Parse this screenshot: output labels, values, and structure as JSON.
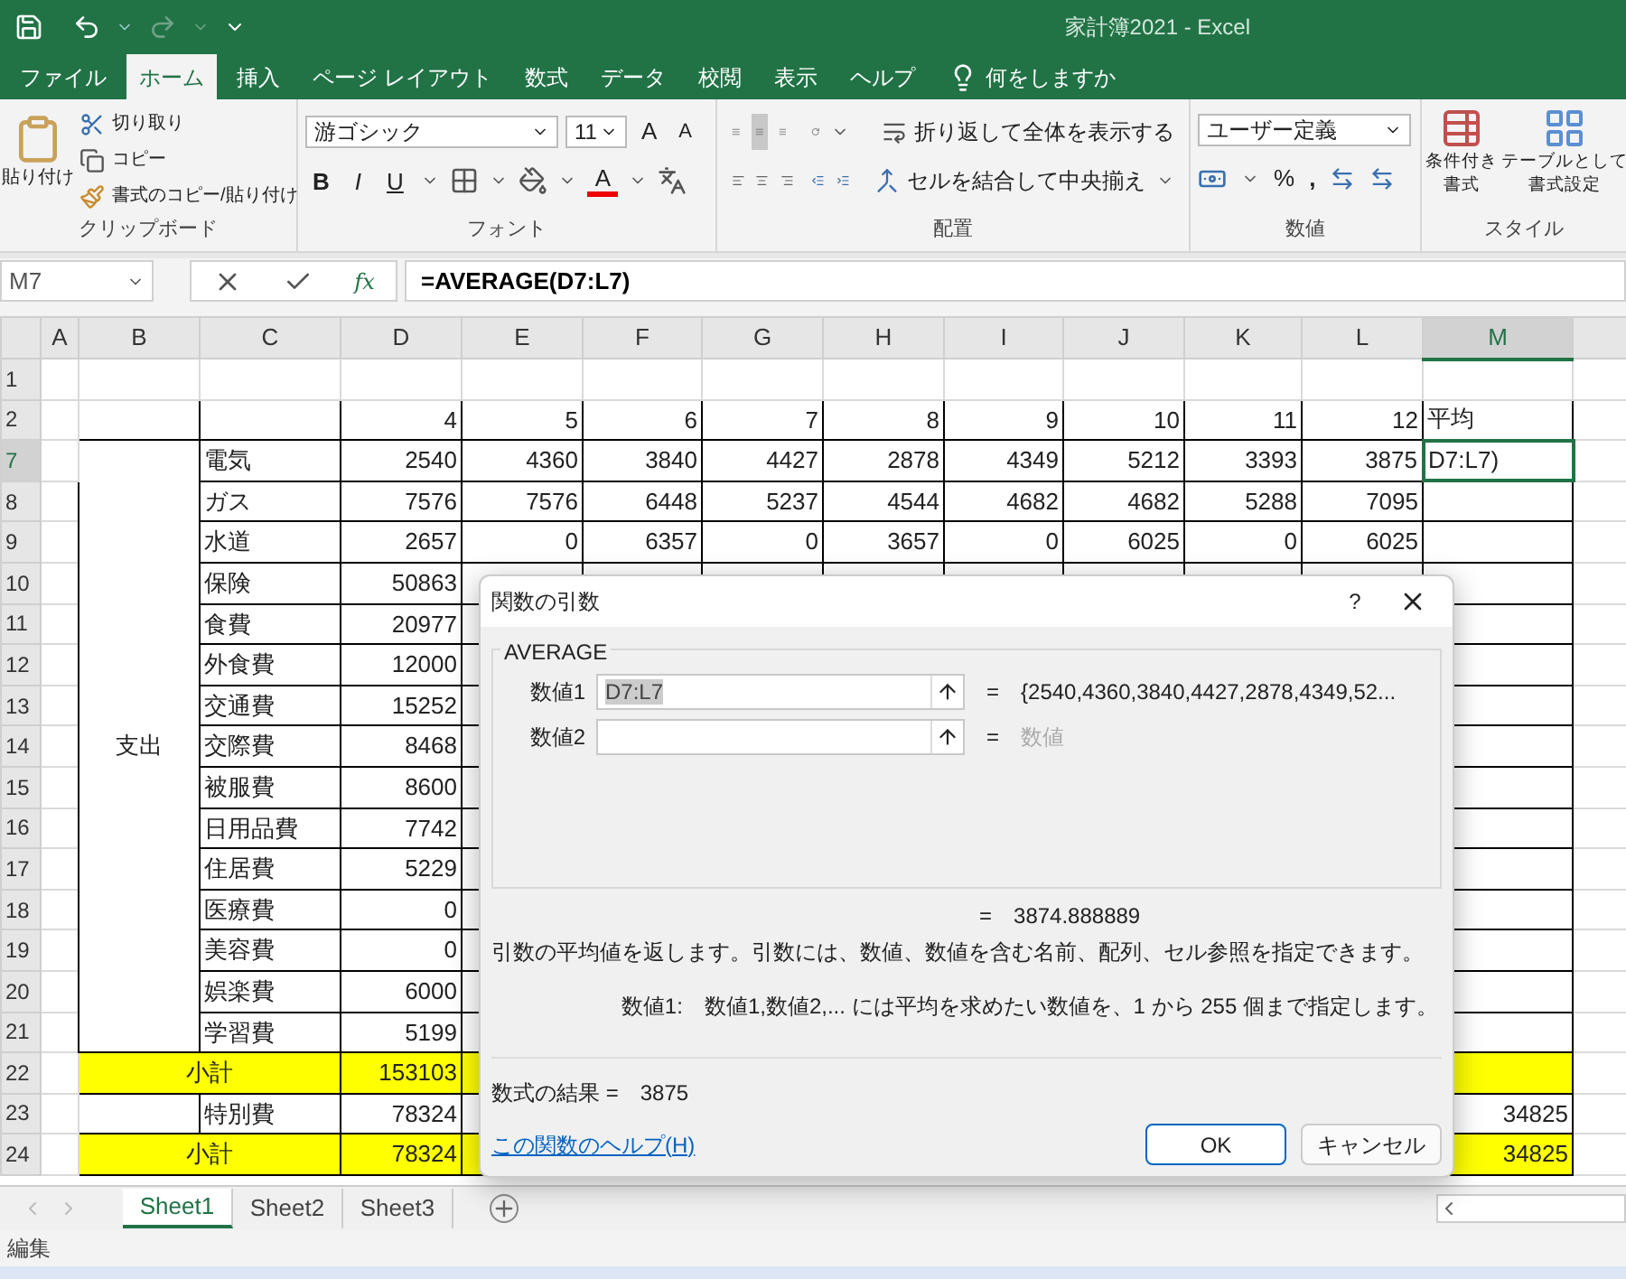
{
  "window": {
    "title": "家計簿2021 - Excel"
  },
  "menu_tabs": [
    {
      "label": "ファイル",
      "selected": false
    },
    {
      "label": "ホーム",
      "selected": true
    },
    {
      "label": "挿入",
      "selected": false
    },
    {
      "label": "ページ レイアウト",
      "selected": false
    },
    {
      "label": "数式",
      "selected": false
    },
    {
      "label": "データ",
      "selected": false
    },
    {
      "label": "校閲",
      "selected": false
    },
    {
      "label": "表示",
      "selected": false
    },
    {
      "label": "ヘルプ",
      "selected": false
    }
  ],
  "tell_me": "何をしますか",
  "ribbon": {
    "clipboard": {
      "paste": "貼り付け",
      "cut": "切り取り",
      "copy": "コピー",
      "format_painter": "書式のコピー/貼り付け",
      "label": "クリップボード"
    },
    "font": {
      "name": "游ゴシック",
      "size": "11",
      "grow": "A",
      "shrink": "A",
      "styles": [
        "B",
        "I",
        "U"
      ],
      "font_color": "A",
      "label": "フォント"
    },
    "alignment": {
      "wrap": "折り返して全体を表示する",
      "merge": "セルを結合して中央揃え",
      "label": "配置"
    },
    "number": {
      "format": "ユーザー定義",
      "percent": "%",
      "comma": ",",
      "label": "数値"
    },
    "styles": {
      "conditional": [
        "条件付き",
        "書式"
      ],
      "table": [
        "テーブルとして",
        "書式設定"
      ],
      "label": "スタイル"
    }
  },
  "formula_bar": {
    "name_box": "M7",
    "fx": "fx",
    "formula": "=AVERAGE(D7:L7)"
  },
  "sheet": {
    "columns": [
      {
        "label": "A",
        "selected": false
      },
      {
        "label": "B",
        "selected": false
      },
      {
        "label": "C",
        "selected": false
      },
      {
        "label": "D",
        "selected": false
      },
      {
        "label": "E",
        "selected": false
      },
      {
        "label": "F",
        "selected": false
      },
      {
        "label": "G",
        "selected": false
      },
      {
        "label": "H",
        "selected": false
      },
      {
        "label": "I",
        "selected": false
      },
      {
        "label": "J",
        "selected": false
      },
      {
        "label": "K",
        "selected": false
      },
      {
        "label": "L",
        "selected": false
      },
      {
        "label": "M",
        "selected": true
      }
    ],
    "rows": [
      {
        "kind": "blank",
        "num": "1",
        "selected": false
      },
      {
        "kind": "header",
        "num": "2",
        "selected": false,
        "values": [
          "4",
          "5",
          "6",
          "7",
          "8",
          "9",
          "10",
          "11",
          "12"
        ],
        "m": {
          "text": "平均",
          "selected": false
        }
      },
      {
        "kind": "group",
        "label": "支出",
        "children": [
          {
            "num": "7",
            "selected": true,
            "c": "電気",
            "values": [
              "2540",
              "4360",
              "3840",
              "4427",
              "2878",
              "4349",
              "5212",
              "3393",
              "3875"
            ],
            "m": {
              "text": "D7:L7)",
              "selected": true
            }
          },
          {
            "num": "8",
            "selected": false,
            "c": "ガス",
            "values": [
              "7576",
              "7576",
              "6448",
              "5237",
              "4544",
              "4682",
              "4682",
              "5288",
              "7095"
            ],
            "m": {
              "selected": false
            }
          },
          {
            "num": "9",
            "selected": false,
            "c": "水道",
            "values": [
              "2657",
              "0",
              "6357",
              "0",
              "3657",
              "0",
              "6025",
              "0",
              "6025"
            ],
            "m": {
              "selected": false
            }
          },
          {
            "num": "10",
            "selected": false,
            "c": "保険",
            "values": [
              "50863"
            ],
            "m": {
              "selected": false
            }
          },
          {
            "num": "11",
            "selected": false,
            "c": "食費",
            "values": [
              "20977"
            ],
            "m": {
              "selected": false
            }
          },
          {
            "num": "12",
            "selected": false,
            "c": "外食費",
            "values": [
              "12000"
            ],
            "m": {
              "selected": false
            }
          },
          {
            "num": "13",
            "selected": false,
            "c": "交通費",
            "values": [
              "15252"
            ],
            "m": {
              "selected": false
            }
          },
          {
            "num": "14",
            "selected": false,
            "c": "交際費",
            "values": [
              "8468"
            ],
            "m": {
              "selected": false
            }
          },
          {
            "num": "15",
            "selected": false,
            "c": "被服費",
            "values": [
              "8600"
            ],
            "m": {
              "selected": false
            }
          },
          {
            "num": "16",
            "selected": false,
            "c": "日用品費",
            "values": [
              "7742"
            ],
            "m": {
              "selected": false
            }
          },
          {
            "num": "17",
            "selected": false,
            "c": "住居費",
            "values": [
              "5229"
            ],
            "m": {
              "selected": false
            }
          },
          {
            "num": "18",
            "selected": false,
            "c": "医療費",
            "values": [
              "0"
            ],
            "m": {
              "selected": false
            }
          },
          {
            "num": "19",
            "selected": false,
            "c": "美容費",
            "values": [
              "0"
            ],
            "m": {
              "selected": false
            }
          },
          {
            "num": "20",
            "selected": false,
            "c": "娯楽費",
            "values": [
              "6000"
            ],
            "m": {
              "selected": false
            }
          },
          {
            "num": "21",
            "selected": false,
            "c": "学習費",
            "values": [
              "5199"
            ],
            "m": {
              "selected": false
            }
          }
        ]
      },
      {
        "kind": "subtotal",
        "num": "22",
        "selected": false,
        "label": "小計",
        "values": [
          "153103"
        ],
        "m": {
          "selected": false
        }
      },
      {
        "kind": "item",
        "num": "23",
        "selected": false,
        "c": "特別費",
        "values": [
          "78324"
        ],
        "m": {
          "text": "34825",
          "selected": false
        }
      },
      {
        "kind": "subtotal",
        "num": "24",
        "selected": false,
        "label": "小計",
        "values": [
          "78324"
        ],
        "m": {
          "text": "34825",
          "selected": false
        }
      }
    ]
  },
  "sheet_tabs": [
    {
      "label": "Sheet1",
      "selected": true
    },
    {
      "label": "Sheet2",
      "selected": false
    },
    {
      "label": "Sheet3",
      "selected": false
    }
  ],
  "status_bar": {
    "mode": "編集"
  },
  "dialog": {
    "title": "関数の引数",
    "help": "?",
    "function": "AVERAGE",
    "args": [
      {
        "label": "数値1",
        "value": "D7:L7",
        "eq": "=",
        "result": "{2540,4360,3840,4427,2878,4349,52...",
        "kind": "value"
      },
      {
        "label": "数値2",
        "eq": "=",
        "result": "数値",
        "kind": "hint"
      }
    ],
    "value_eq": "=",
    "value": "3874.888889",
    "description": "引数の平均値を返します。引数には、数値、数値を含む名前、配列、セル参照を指定できます。",
    "arg_help_label": "数値1:",
    "arg_help": "数値1,数値2,... には平均を求めたい数値を、1 から 255 個まで指定します。",
    "result_label": "数式の結果 =",
    "result": "3875",
    "help_link": "この関数のヘルプ(H)",
    "ok": "OK",
    "cancel": "キャンセル"
  }
}
